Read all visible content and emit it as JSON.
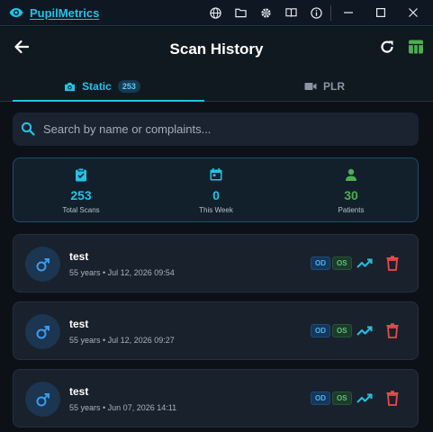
{
  "app": {
    "title": "PupilMetrics"
  },
  "header": {
    "title": "Scan History"
  },
  "tabs": [
    {
      "label": "Static",
      "badge": "253",
      "icon": "camera-icon"
    },
    {
      "label": "PLR",
      "icon": "video-camera-icon"
    }
  ],
  "search": {
    "placeholder": "Search by name or complaints..."
  },
  "stats": [
    {
      "value": "253",
      "label": "Total Scans",
      "icon": "clipboard-icon",
      "color": "#22c3e6"
    },
    {
      "value": "0",
      "label": "This Week",
      "icon": "calendar-icon",
      "color": "#22c3e6"
    },
    {
      "value": "30",
      "label": "Patients",
      "icon": "person-icon",
      "color": "#4caf50"
    }
  ],
  "scans": [
    {
      "name": "test",
      "meta": "55 years • Jul 12, 2026 09:54",
      "od": "OD",
      "os": "OS"
    },
    {
      "name": "test",
      "meta": "55 years • Jul 12, 2026 09:27",
      "od": "OD",
      "os": "OS"
    },
    {
      "name": "test",
      "meta": "55 years • Jun 07, 2026 14:11",
      "od": "OD",
      "os": "OS"
    }
  ],
  "colors": {
    "accent": "#22c3e6",
    "danger": "#e84a4a",
    "success": "#4caf50",
    "od": "#4ab4f0"
  }
}
